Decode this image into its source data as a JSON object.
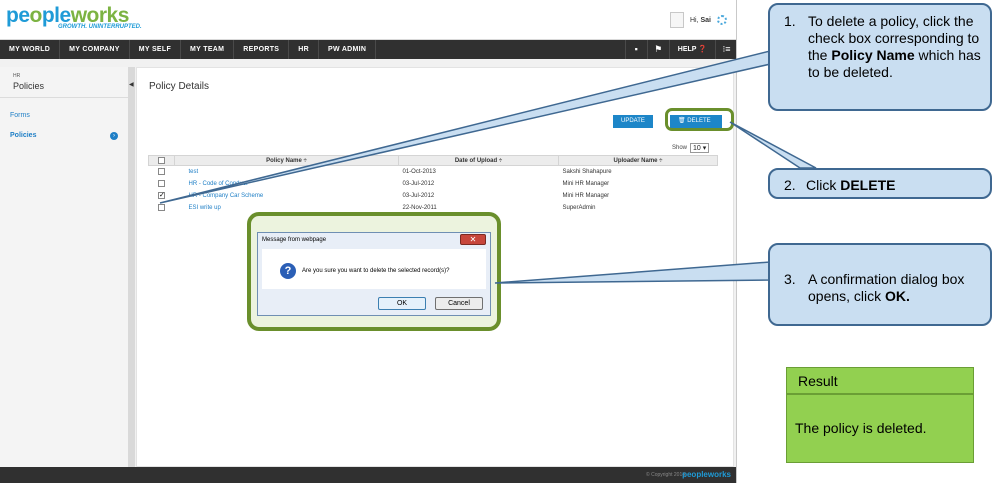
{
  "header": {
    "logo_brand_a": "pe",
    "logo_brand_b": "ple",
    "logo_brand_c": "works",
    "tagline": "GROWTH. UNINTERRUPTED.",
    "greeting": "Hi,",
    "user_name": "Sai"
  },
  "nav": {
    "items": [
      "MY WORLD",
      "MY COMPANY",
      "MY SELF",
      "MY TEAM",
      "REPORTS",
      "HR",
      "PW ADMIN"
    ],
    "help": "HELP"
  },
  "sidebar": {
    "section_small": "HR",
    "section_title": "Policies",
    "links": [
      "Forms",
      "Policies"
    ]
  },
  "page": {
    "title": "Policy Details",
    "update_label": "UPDATE",
    "delete_label": "DELETE",
    "show_label": "Show",
    "show_value": "10"
  },
  "table": {
    "headers": [
      "Policy Name ÷",
      "Date of Upload ÷",
      "Uploader Name ÷"
    ],
    "rows": [
      {
        "name": "test",
        "date": "01-Oct-2013",
        "uploader": "Sakshi Shahapure",
        "checked": false
      },
      {
        "name": "HR - Code of Conduct",
        "date": "03-Jul-2012",
        "uploader": "Mini HR Manager",
        "checked": false
      },
      {
        "name": "HR - Company Car Scheme",
        "date": "03-Jul-2012",
        "uploader": "Mini HR Manager",
        "checked": true
      },
      {
        "name": "ESI write up",
        "date": "22-Nov-2011",
        "uploader": "SuperAdmin",
        "checked": false
      }
    ]
  },
  "dialog": {
    "title": "Message from webpage",
    "message": "Are you sure you want to delete the selected record(s)?",
    "ok_label": "OK",
    "cancel_label": "Cancel"
  },
  "footer": {
    "copyright": "© Copyright 2014",
    "logo": "peopleworks"
  },
  "callouts": {
    "c1_num": "1.",
    "c1_pre": "To delete a policy, click the check box corresponding to the",
    "c1_bold": "Policy Name",
    "c1_post": "which has to be deleted.",
    "c2_num": "2.",
    "c2_pre": "Click",
    "c2_bold": "DELETE",
    "c3_num": "3.",
    "c3_pre": "A confirmation dialog box opens, click",
    "c3_bold": "OK."
  },
  "result": {
    "heading": "Result",
    "text": "The policy is deleted."
  },
  "colors": {
    "accent": "#1d86c8",
    "highlight_border": "#6a8f2c",
    "callout_fill": "#c9def1",
    "result_fill": "#92d050"
  }
}
